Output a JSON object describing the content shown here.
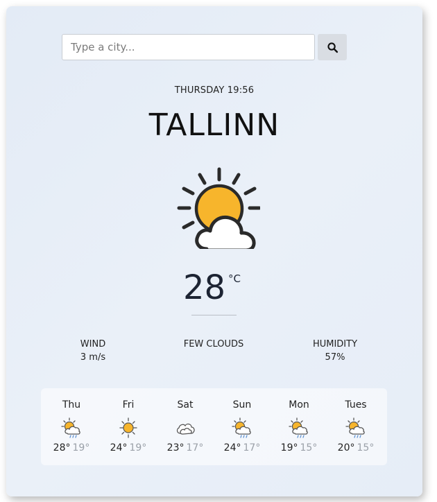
{
  "search": {
    "placeholder": "Type a city...",
    "icon": "search-icon"
  },
  "current": {
    "datetime": "THURSDAY 19:56",
    "city": "TALLINN",
    "icon": "partly-cloudy-icon",
    "temperature": "28",
    "unit": "°C",
    "wind_label": "WIND",
    "wind_value": "3 m/s",
    "description": "FEW CLOUDS",
    "humidity_label": "HUMIDITY",
    "humidity_value": "57%"
  },
  "forecast": [
    {
      "day": "Thu",
      "icon": "sun-cloud-rain-icon",
      "hi": "28°",
      "lo": "19°"
    },
    {
      "day": "Fri",
      "icon": "sun-icon",
      "hi": "24°",
      "lo": "19°"
    },
    {
      "day": "Sat",
      "icon": "cloud-icon",
      "hi": "23°",
      "lo": "17°"
    },
    {
      "day": "Sun",
      "icon": "sun-cloud-rain-icon",
      "hi": "24°",
      "lo": "17°"
    },
    {
      "day": "Mon",
      "icon": "sun-cloud-rain-icon",
      "hi": "19°",
      "lo": "15°"
    },
    {
      "day": "Tues",
      "icon": "sun-cloud-rain-icon",
      "hi": "20°",
      "lo": "15°"
    }
  ],
  "colors": {
    "sun": "#f7b52c",
    "outline": "#2a2a2a",
    "card_bg": "#e6edf7"
  }
}
